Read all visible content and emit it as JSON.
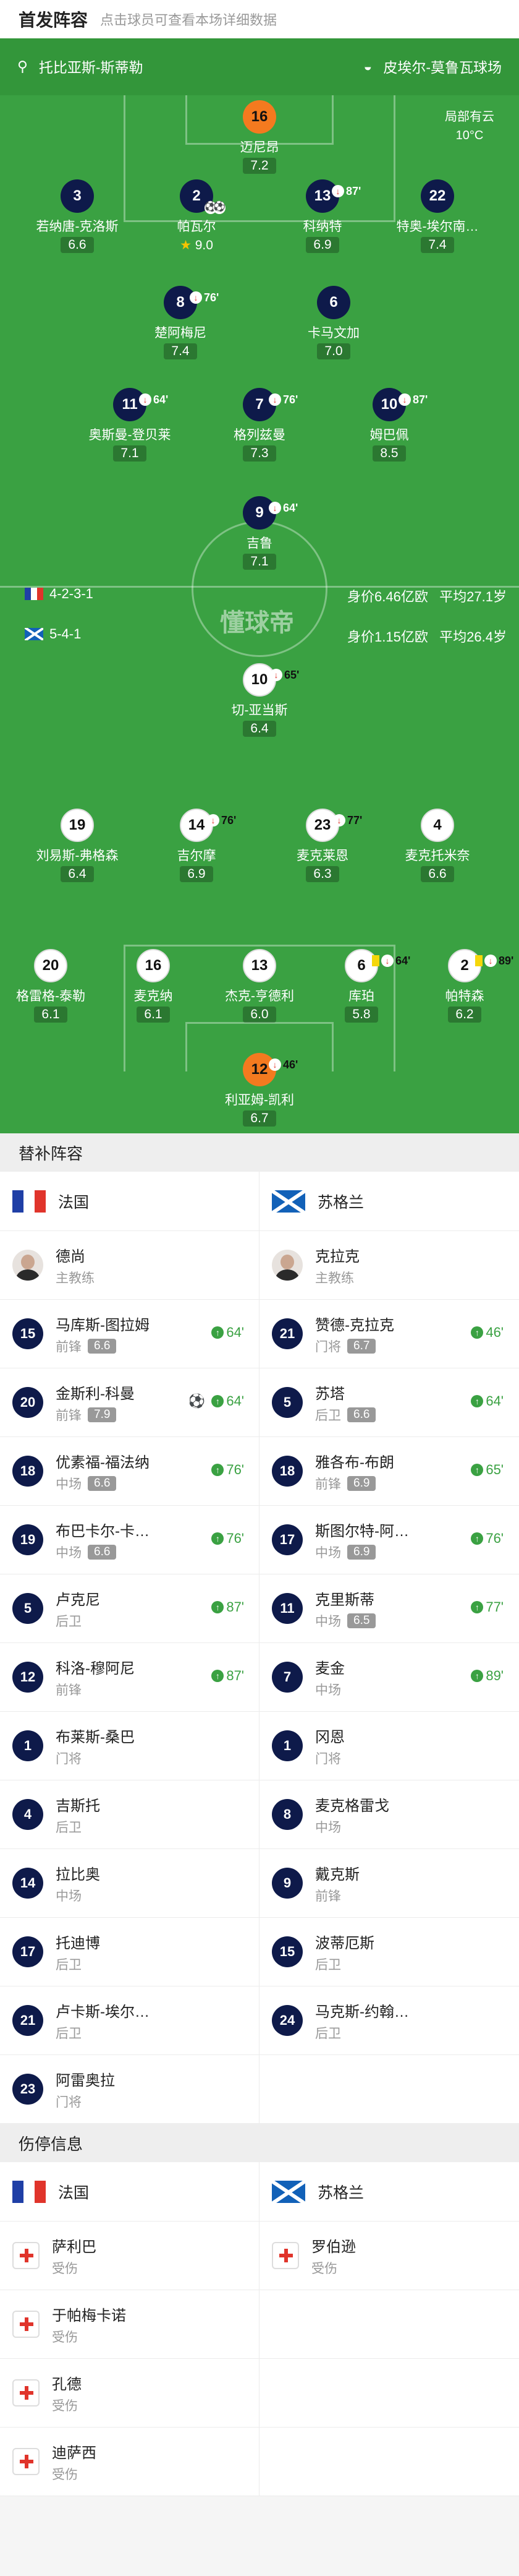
{
  "header": {
    "title": "首发阵容",
    "subtitle": "点击球员可查看本场详细数据"
  },
  "pitch_bar": {
    "home_label": "托比亚斯-斯蒂勒",
    "away_label": "皮埃尔-莫鲁瓦球场",
    "weather": "局部有云",
    "temperature": "10°C"
  },
  "france": {
    "formation": "4-2-3-1",
    "value": "身价6.46亿欧",
    "age": "平均27.1岁",
    "players": [
      {
        "no": "16",
        "name": "迈尼昂",
        "rating": "7.2"
      },
      {
        "no": "3",
        "name": "若纳唐-克洛斯",
        "rating": "6.6"
      },
      {
        "no": "2",
        "name": "帕瓦尔",
        "rating": "9.0"
      },
      {
        "no": "13",
        "name": "科纳特",
        "rating": "6.9",
        "sub": "87'"
      },
      {
        "no": "22",
        "name": "特奥-埃尔南…",
        "rating": "7.4"
      },
      {
        "no": "8",
        "name": "楚阿梅尼",
        "rating": "7.4",
        "sub": "76'"
      },
      {
        "no": "6",
        "name": "卡马文加",
        "rating": "7.0"
      },
      {
        "no": "11",
        "name": "奥斯曼-登贝莱",
        "rating": "7.1",
        "sub": "64'"
      },
      {
        "no": "7",
        "name": "格列兹曼",
        "rating": "7.3",
        "sub": "76'"
      },
      {
        "no": "10",
        "name": "姆巴佩",
        "rating": "8.5",
        "sub": "87'"
      },
      {
        "no": "9",
        "name": "吉鲁",
        "rating": "7.1",
        "sub": "64'"
      }
    ]
  },
  "scotland": {
    "formation": "5-4-1",
    "value": "身价1.15亿欧",
    "age": "平均26.4岁",
    "players": [
      {
        "no": "10",
        "name": "切-亚当斯",
        "rating": "6.4",
        "sub": "65'"
      },
      {
        "no": "19",
        "name": "刘易斯-弗格森",
        "rating": "6.4"
      },
      {
        "no": "14",
        "name": "吉尔摩",
        "rating": "6.9",
        "sub": "76'"
      },
      {
        "no": "23",
        "name": "麦克莱恩",
        "rating": "6.3",
        "sub": "77'"
      },
      {
        "no": "4",
        "name": "麦克托米奈",
        "rating": "6.6"
      },
      {
        "no": "20",
        "name": "格雷格-泰勒",
        "rating": "6.1"
      },
      {
        "no": "16",
        "name": "麦克纳",
        "rating": "6.1"
      },
      {
        "no": "13",
        "name": "杰克-亨德利",
        "rating": "6.0"
      },
      {
        "no": "6",
        "name": "库珀",
        "rating": "5.8",
        "sub": "64'"
      },
      {
        "no": "2",
        "name": "帕特森",
        "rating": "6.2",
        "sub": "89'"
      },
      {
        "no": "12",
        "name": "利亚姆-凯利",
        "rating": "6.7",
        "sub": "46'"
      }
    ]
  },
  "subs": {
    "title": "替补阵容",
    "home_team": "法国",
    "away_team": "苏格兰",
    "home_coach": {
      "name": "德尚",
      "role": "主教练"
    },
    "away_coach": {
      "name": "克拉克",
      "role": "主教练"
    },
    "home": [
      {
        "no": "15",
        "name": "马库斯-图拉姆",
        "pos": "前锋",
        "rating": "6.6",
        "minute": "64'"
      },
      {
        "no": "20",
        "name": "金斯利-科曼",
        "pos": "前锋",
        "rating": "7.9",
        "minute": "64'"
      },
      {
        "no": "18",
        "name": "优素福-福法纳",
        "pos": "中场",
        "rating": "6.6",
        "minute": "76'"
      },
      {
        "no": "19",
        "name": "布巴卡尔-卡…",
        "pos": "中场",
        "rating": "6.6",
        "minute": "76'"
      },
      {
        "no": "5",
        "name": "卢克尼",
        "pos": "后卫",
        "rating": "",
        "minute": "87'"
      },
      {
        "no": "12",
        "name": "科洛-穆阿尼",
        "pos": "前锋",
        "rating": "",
        "minute": "87'"
      },
      {
        "no": "1",
        "name": "布莱斯-桑巴",
        "pos": "门将"
      },
      {
        "no": "4",
        "name": "吉斯托",
        "pos": "后卫"
      },
      {
        "no": "14",
        "name": "拉比奥",
        "pos": "中场"
      },
      {
        "no": "17",
        "name": "托迪博",
        "pos": "后卫"
      },
      {
        "no": "21",
        "name": "卢卡斯-埃尔…",
        "pos": "后卫"
      },
      {
        "no": "23",
        "name": "阿雷奥拉",
        "pos": "门将"
      }
    ],
    "away": [
      {
        "no": "21",
        "name": "赞德-克拉克",
        "pos": "门将",
        "rating": "6.7",
        "minute": "46'"
      },
      {
        "no": "5",
        "name": "苏塔",
        "pos": "后卫",
        "rating": "6.6",
        "minute": "64'"
      },
      {
        "no": "18",
        "name": "雅各布-布朗",
        "pos": "前锋",
        "rating": "6.9",
        "minute": "65'"
      },
      {
        "no": "17",
        "name": "斯图尔特-阿…",
        "pos": "中场",
        "rating": "6.9",
        "minute": "76'"
      },
      {
        "no": "11",
        "name": "克里斯蒂",
        "pos": "中场",
        "rating": "6.5",
        "minute": "77'"
      },
      {
        "no": "7",
        "name": "麦金",
        "pos": "中场",
        "rating": "",
        "minute": "89'"
      },
      {
        "no": "1",
        "name": "冈恩",
        "pos": "门将"
      },
      {
        "no": "8",
        "name": "麦克格雷戈",
        "pos": "中场"
      },
      {
        "no": "9",
        "name": "戴克斯",
        "pos": "前锋"
      },
      {
        "no": "15",
        "name": "波蒂厄斯",
        "pos": "后卫"
      },
      {
        "no": "24",
        "name": "马克斯-约翰…",
        "pos": "后卫"
      }
    ]
  },
  "injuries": {
    "title": "伤停信息",
    "home_team": "法国",
    "away_team": "苏格兰",
    "home": [
      {
        "name": "萨利巴",
        "status": "受伤"
      },
      {
        "name": "于帕梅卡诺",
        "status": "受伤"
      },
      {
        "name": "孔德",
        "status": "受伤"
      },
      {
        "name": "迪萨西",
        "status": "受伤"
      }
    ],
    "away": [
      {
        "name": "罗伯逊",
        "status": "受伤"
      }
    ]
  },
  "watermark": "懂球帝"
}
